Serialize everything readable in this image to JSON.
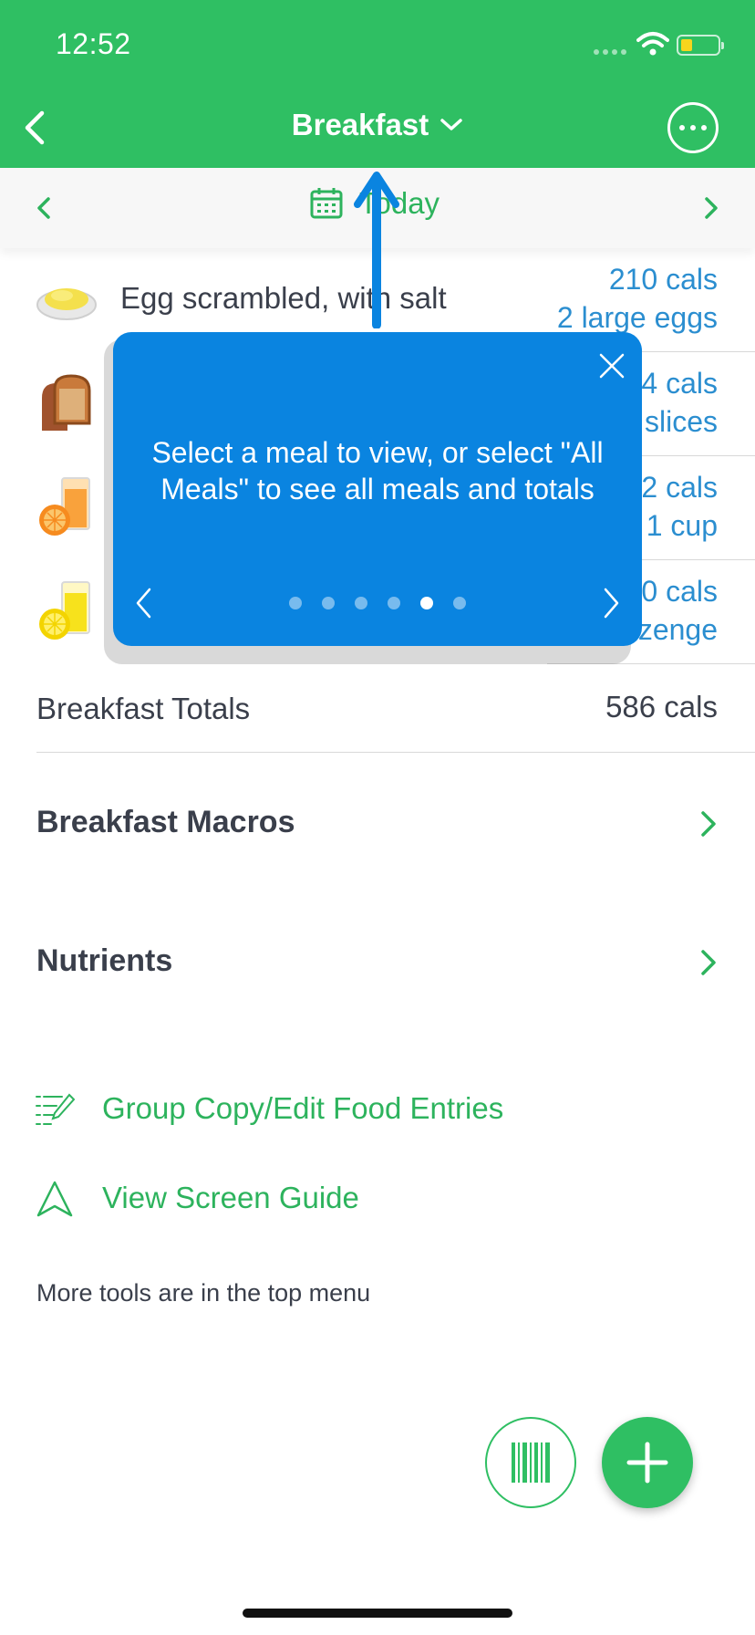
{
  "status_bar": {
    "time": "12:52"
  },
  "header": {
    "title": "Breakfast"
  },
  "date_bar": {
    "label": "Today"
  },
  "foods": [
    {
      "name": "Egg scrambled, with salt",
      "cals": "210 cals",
      "qty": "2 large eggs",
      "icon": "scrambled-egg-icon"
    },
    {
      "name": "",
      "cals": "4 cals",
      "qty": "slices",
      "icon": "toast-icon"
    },
    {
      "name": "",
      "cals": "2 cals",
      "qty": "1 cup",
      "icon": "orange-juice-icon"
    },
    {
      "name": "",
      "cals": "0 cals",
      "qty": "lozenge",
      "icon": "lemonade-icon"
    }
  ],
  "totals": {
    "label": "Breakfast Totals",
    "value": "586 cals"
  },
  "sections": {
    "macros": "Breakfast Macros",
    "nutrients": "Nutrients"
  },
  "tools": {
    "group_copy": "Group Copy/Edit Food Entries",
    "screen_guide": "View Screen Guide"
  },
  "hint": "More tools are in the top menu",
  "tooltip": {
    "text": "Select a meal to view, or select \"All Meals\" to see all meals and totals",
    "page_count": 6,
    "active_page": 5
  },
  "colors": {
    "brand_green": "#2fbf63",
    "link_blue": "#2b8ed0",
    "tooltip_blue": "#0a84e0"
  }
}
